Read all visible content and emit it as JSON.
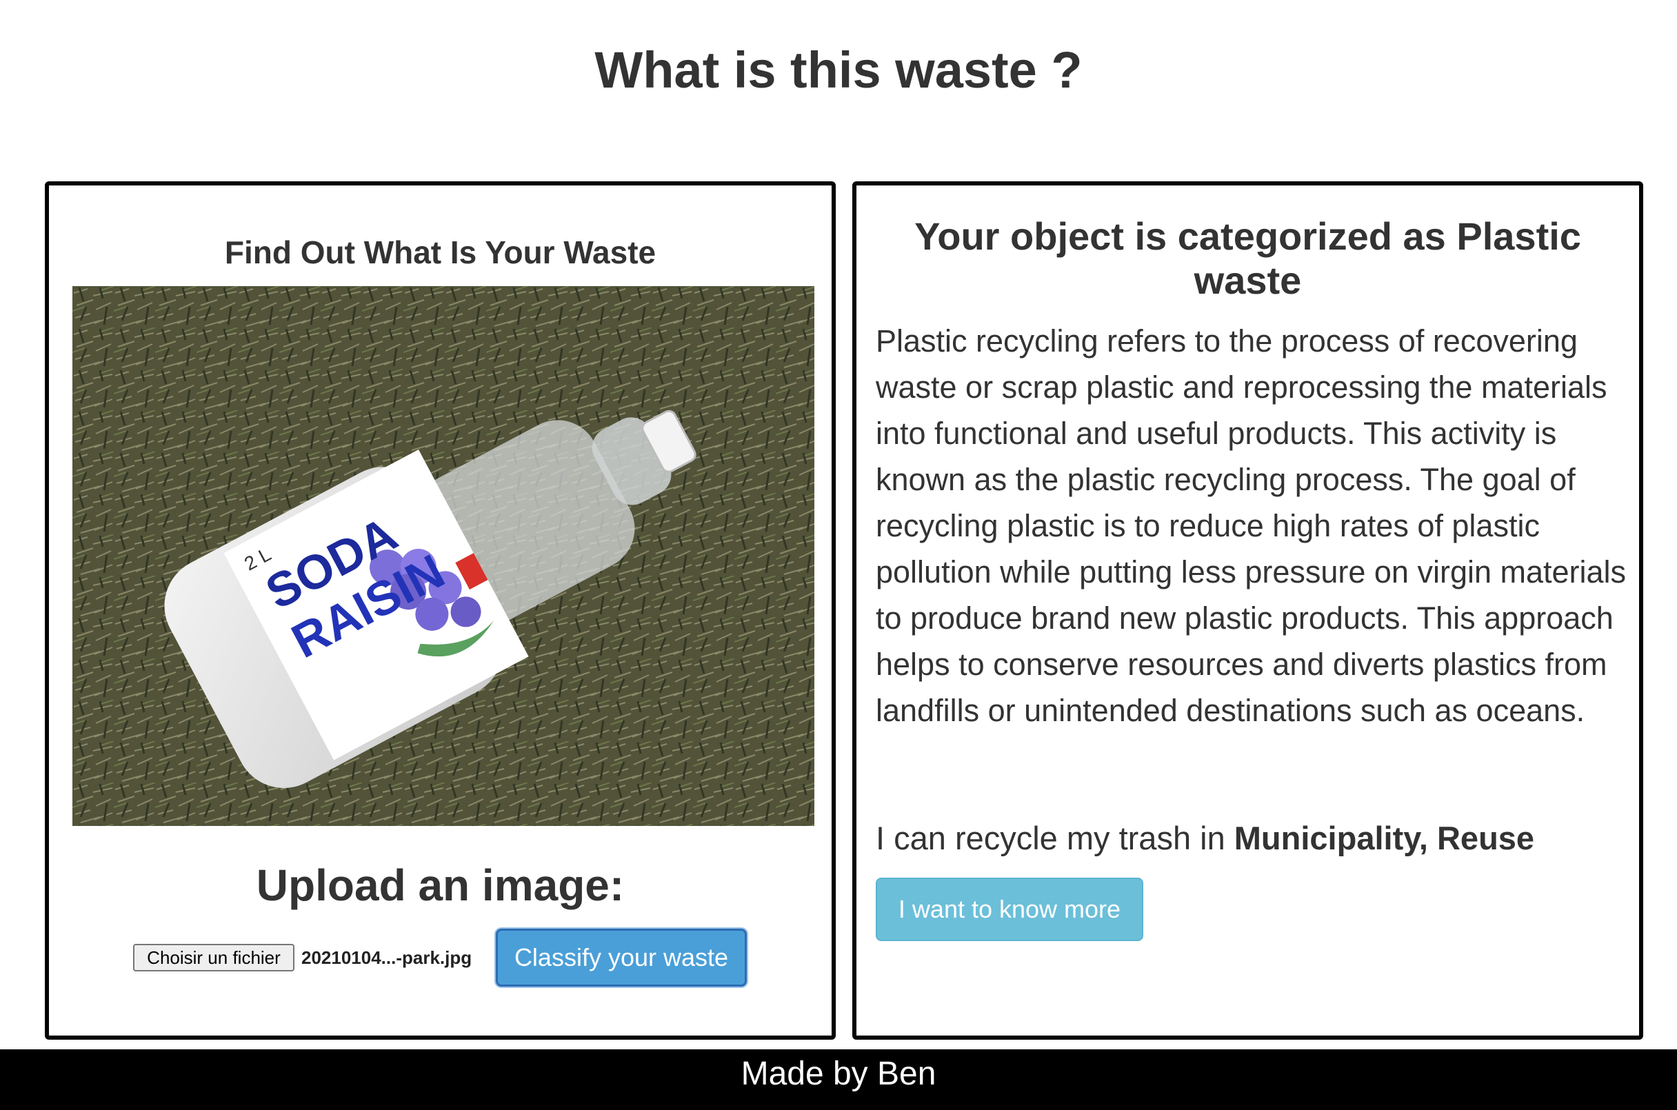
{
  "page": {
    "title": "What is this waste ?"
  },
  "upload_panel": {
    "heading": "Find Out What Is Your Waste",
    "image_alt": "Crushed SODA RAISIN plastic bottle lying on grass",
    "image_text": {
      "brand_line1": "SODA",
      "brand_line2": "RAISIN",
      "volume": "2 L"
    },
    "upload_label": "Upload an image:",
    "file_button_label": "Choisir un fichier",
    "file_name": "20210104...-park.jpg",
    "classify_button_label": "Classify your waste"
  },
  "result_panel": {
    "heading_prefix": "Your object is categorized as",
    "category": "Plastic waste",
    "description": "Plastic recycling refers to the process of recovering waste or scrap plastic and reprocessing the materials into functional and useful products. This activity is known as the plastic recycling process. The goal of recycling plastic is to reduce high rates of plastic pollution while putting less pressure on virgin materials to produce brand new plastic products. This approach helps to conserve resources and diverts plastics from landfills or unintended destinations such as oceans.",
    "recycle_prefix": "I can recycle my trash in",
    "recycle_places": "Municipality, Reuse",
    "more_button_label": "I want to know more"
  },
  "footer": {
    "text": "Made by Ben"
  },
  "colors": {
    "classify_button": "#4a9fd8",
    "more_button": "#6cbfd9",
    "footer_background": "#000000"
  }
}
